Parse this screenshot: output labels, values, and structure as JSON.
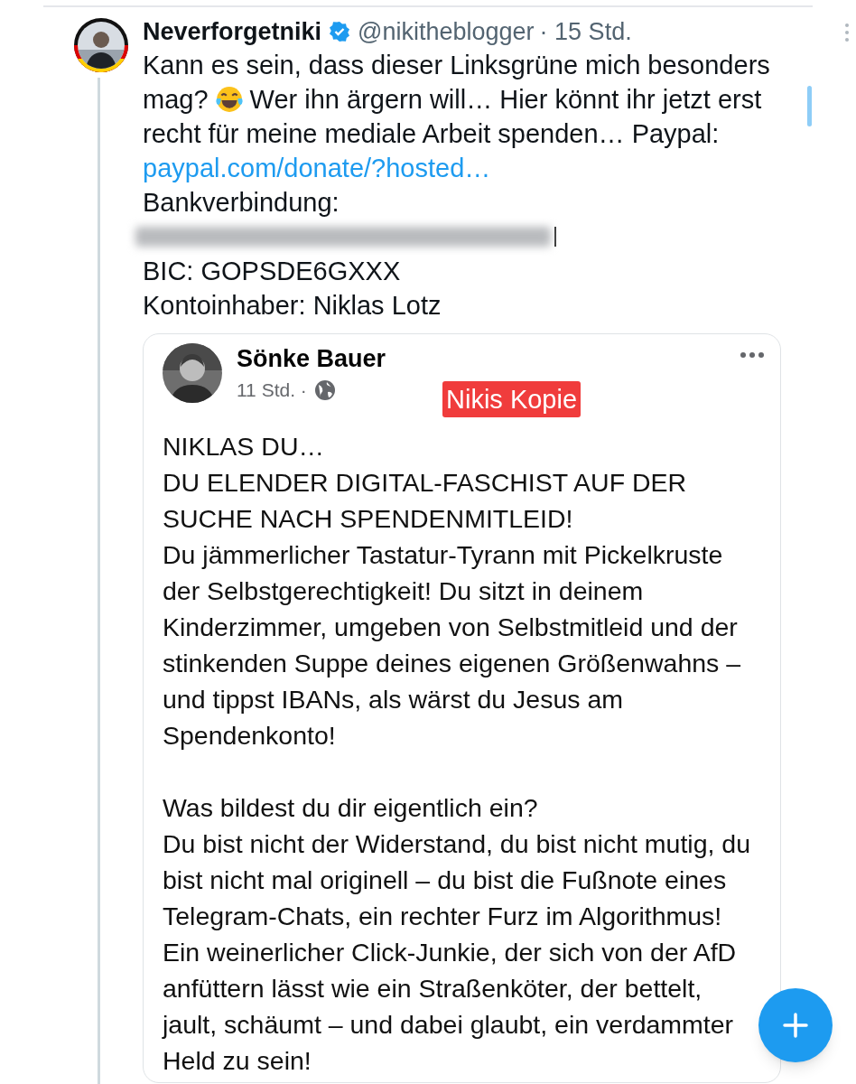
{
  "tweet": {
    "author": {
      "name": "Neverforgetniki",
      "verified": true,
      "handle": "@nikitheblogger",
      "time": "· 15 Std."
    },
    "text_rows": [
      [
        {
          "kind": "text",
          "text": "Kann es sein, dass dieser Linksgrüne mich besonders"
        }
      ],
      [
        {
          "kind": "text",
          "text": "mag?"
        },
        {
          "kind": "emoji"
        },
        {
          "kind": "text",
          "text": "Wer ihn ärgern will… Hier könnt ihr jetzt erst"
        }
      ],
      [
        {
          "kind": "text",
          "text": "recht für meine mediale Arbeit spenden… Paypal:"
        }
      ]
    ],
    "link": "paypal.com/donate/?hosted…",
    "lines": [
      {
        "kind": "text",
        "text": "Bankverbindung:"
      },
      {
        "kind": "redacted"
      },
      {
        "kind": "text",
        "text": "BIC: GOPSDE6GXXX"
      },
      {
        "kind": "text",
        "text": "Kontoinhaber: Niklas Lotz"
      }
    ],
    "quoted_post": {
      "author": "Sönke Bauer",
      "time": "11 Std. ·",
      "label": "Nikis Kopie",
      "blocks": [
        [
          "NIKLAS DU…",
          "DU ELENDER DIGITAL-FASCHIST AUF DER SUCHE NACH SPENDENMITLEID!",
          "Du jämmerlicher Tastatur-Tyrann mit Pickelkruste der Selbstgerechtigkeit! Du sitzt in deinem Kinderzimmer, umgeben von Selbstmitleid und der stinkenden Suppe deines eigenen Größenwahns – und tippst IBANs, als wärst du Jesus am Spendenkonto!"
        ],
        [
          "Was bildest du dir eigentlich ein?",
          "Du bist nicht der Widerstand, du bist nicht mutig, du bist nicht mal originell – du bist die Fußnote eines Telegram-Chats, ein rechter Furz im Algorithmus! Ein weinerlicher Click-Junkie, der sich von der AfD anfüttern lässt wie ein Straßenköter, der bettelt, jault, schäumt – und dabei glaubt, ein verdammter Held zu sein!"
        ]
      ]
    }
  }
}
